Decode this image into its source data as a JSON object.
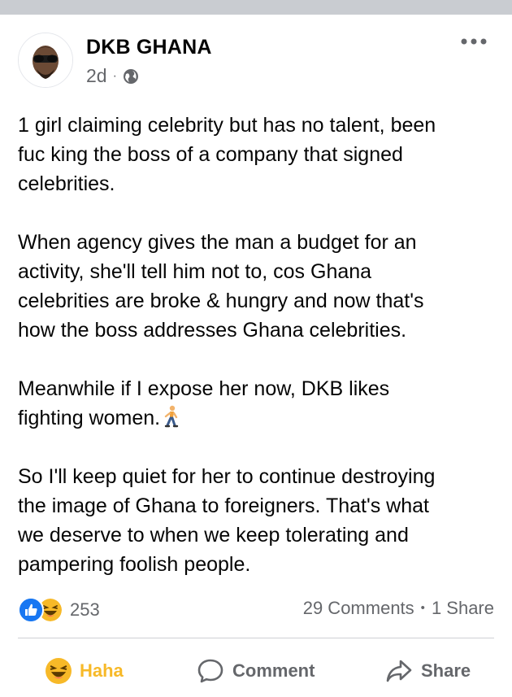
{
  "post": {
    "author": "DKB GHANA",
    "time": "2d",
    "dot": "·",
    "privacy_icon": "globe-icon",
    "paragraphs": [
      "1 girl claiming celebrity but has no talent, been\nfuc king the boss of a company that signed\ncelebrities.",
      "When agency gives the man a budget for an\nactivity, she'll tell him not to, cos Ghana\ncelebrities are broke & hungry and now that's\nhow the boss addresses Ghana celebrities.",
      "Meanwhile if I expose her now, DKB likes\nfighting women.",
      "So I'll keep quiet for her to continue destroying\nthe image of Ghana to foreigners. That's what\nwe deserve to when we keep tolerating and\npampering foolish people."
    ],
    "inline_emoji": "person-running-emoji"
  },
  "reactions": {
    "icons": [
      "like-icon",
      "haha-icon"
    ],
    "count": "253",
    "comments": "29 Comments",
    "sep": "•",
    "shares": "1 Share"
  },
  "actions": {
    "haha": "Haha",
    "comment": "Comment",
    "share": "Share"
  },
  "colors": {
    "like": "#1877f2",
    "haha": "#f7b928",
    "muted": "#65676b",
    "topbar": "#c9ccd1"
  }
}
